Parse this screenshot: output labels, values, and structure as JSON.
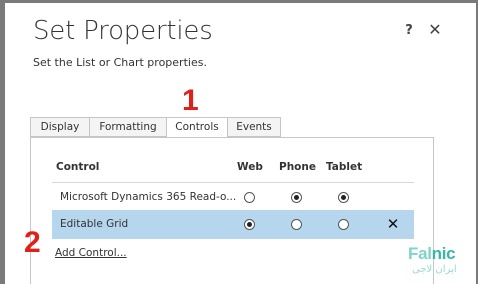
{
  "dialog": {
    "title": "Set Properties",
    "subtitle": "Set the List or Chart properties.",
    "help_label": "?",
    "close_label": "✕"
  },
  "annotations": {
    "marker_1": "1",
    "marker_2": "2"
  },
  "tabs": [
    {
      "label": "Display",
      "active": false
    },
    {
      "label": "Formatting",
      "active": false
    },
    {
      "label": "Controls",
      "active": true
    },
    {
      "label": "Events",
      "active": false
    }
  ],
  "controls_table": {
    "headers": {
      "control": "Control",
      "web": "Web",
      "phone": "Phone",
      "tablet": "Tablet"
    },
    "rows": [
      {
        "label": "Microsoft Dynamics 365 Read-o...",
        "web": false,
        "phone": true,
        "tablet": true,
        "selected": false
      },
      {
        "label": "Editable Grid",
        "web": true,
        "phone": false,
        "tablet": false,
        "selected": true,
        "remove_label": "✕"
      }
    ]
  },
  "add_control_label": "Add Control...",
  "watermark": {
    "brand_a": "Fal",
    "brand_b": "nic",
    "persian": "ایران لاجی"
  },
  "colors": {
    "selected_row": "#b6d6ee",
    "annotation_red": "#e0201b"
  }
}
